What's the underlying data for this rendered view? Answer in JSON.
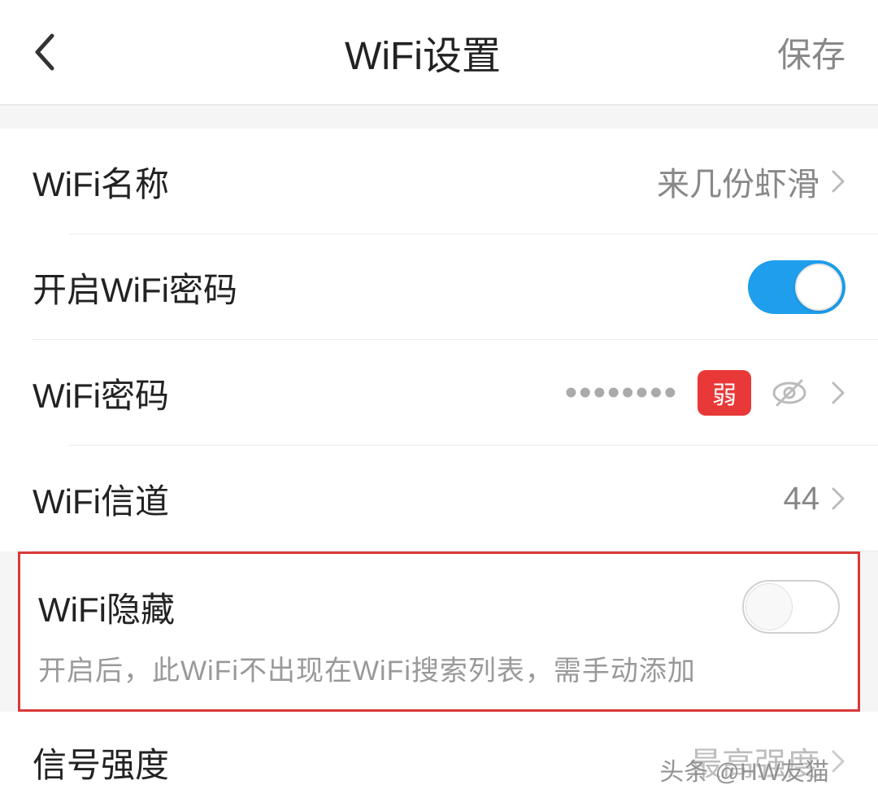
{
  "header": {
    "title": "WiFi设置",
    "save_label": "保存"
  },
  "rows": {
    "name": {
      "label": "WiFi名称",
      "value": "来几份虾滑"
    },
    "enable_pw": {
      "label": "开启WiFi密码",
      "toggle": true
    },
    "password": {
      "label": "WiFi密码",
      "masked": "••••••••",
      "strength": "弱"
    },
    "channel": {
      "label": "WiFi信道",
      "value": "44"
    },
    "hidden": {
      "label": "WiFi隐藏",
      "desc": "开启后，此WiFi不出现在WiFi搜索列表，需手动添加",
      "toggle": false
    },
    "signal": {
      "label": "信号强度",
      "value": "最高强度"
    }
  },
  "watermark": "头条 @HW友猫"
}
